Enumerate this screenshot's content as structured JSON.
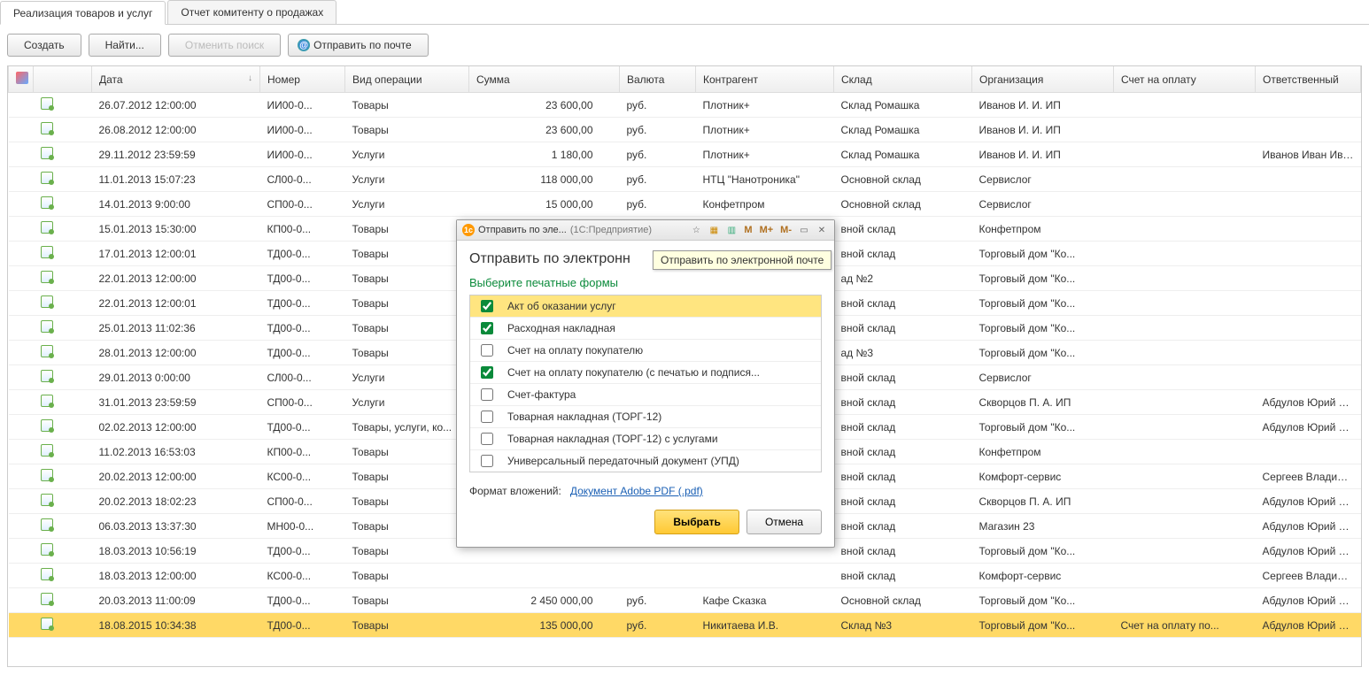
{
  "tabs": [
    {
      "label": "Реализация товаров и услуг",
      "active": true
    },
    {
      "label": "Отчет комитенту о продажах",
      "active": false
    }
  ],
  "toolbar": {
    "create": "Создать",
    "find": "Найти...",
    "cancel_search": "Отменить поиск",
    "send_email": "Отправить по почте"
  },
  "columns": [
    "",
    "",
    "Дата",
    "Номер",
    "Вид операции",
    "Сумма",
    "Валюта",
    "Контрагент",
    "Склад",
    "Организация",
    "Счет на оплату",
    "Ответственный"
  ],
  "rows": [
    {
      "date": "26.07.2012 12:00:00",
      "num": "ИИ00-0...",
      "op": "Товары",
      "sum": "23 600,00",
      "cur": "руб.",
      "cp": "Плотник+",
      "wh": "Склад Ромашка",
      "org": "Иванов И. И. ИП",
      "inv": "",
      "resp": ""
    },
    {
      "date": "26.08.2012 12:00:00",
      "num": "ИИ00-0...",
      "op": "Товары",
      "sum": "23 600,00",
      "cur": "руб.",
      "cp": "Плотник+",
      "wh": "Склад Ромашка",
      "org": "Иванов И. И. ИП",
      "inv": "",
      "resp": ""
    },
    {
      "date": "29.11.2012 23:59:59",
      "num": "ИИ00-0...",
      "op": "Услуги",
      "sum": "1 180,00",
      "cur": "руб.",
      "cp": "Плотник+",
      "wh": "Склад Ромашка",
      "org": "Иванов И. И. ИП",
      "inv": "",
      "resp": "Иванов Иван Иван..."
    },
    {
      "date": "11.01.2013 15:07:23",
      "num": "СЛ00-0...",
      "op": "Услуги",
      "sum": "118 000,00",
      "cur": "руб.",
      "cp": "НТЦ \"Нанотроника\"",
      "wh": "Основной склад",
      "org": "Сервислог",
      "inv": "",
      "resp": ""
    },
    {
      "date": "14.01.2013 9:00:00",
      "num": "СП00-0...",
      "op": "Услуги",
      "sum": "15 000,00",
      "cur": "руб.",
      "cp": "Конфетпром",
      "wh": "Основной склад",
      "org": "Сервислог",
      "inv": "",
      "resp": ""
    },
    {
      "date": "15.01.2013 15:30:00",
      "num": "КП00-0...",
      "op": "Товары",
      "sum": "",
      "cur": "",
      "cp": "",
      "wh": "вной склад",
      "org": "Конфетпром",
      "inv": "",
      "resp": ""
    },
    {
      "date": "17.01.2013 12:00:01",
      "num": "ТД00-0...",
      "op": "Товары",
      "sum": "",
      "cur": "",
      "cp": "",
      "wh": "вной склад",
      "org": "Торговый дом \"Ко...",
      "inv": "",
      "resp": ""
    },
    {
      "date": "22.01.2013 12:00:00",
      "num": "ТД00-0...",
      "op": "Товары",
      "sum": "",
      "cur": "",
      "cp": "",
      "wh": "ад №2",
      "org": "Торговый дом \"Ко...",
      "inv": "",
      "resp": ""
    },
    {
      "date": "22.01.2013 12:00:01",
      "num": "ТД00-0...",
      "op": "Товары",
      "sum": "",
      "cur": "",
      "cp": "",
      "wh": "вной склад",
      "org": "Торговый дом \"Ко...",
      "inv": "",
      "resp": ""
    },
    {
      "date": "25.01.2013 11:02:36",
      "num": "ТД00-0...",
      "op": "Товары",
      "sum": "",
      "cur": "",
      "cp": "",
      "wh": "вной склад",
      "org": "Торговый дом \"Ко...",
      "inv": "",
      "resp": ""
    },
    {
      "date": "28.01.2013 12:00:00",
      "num": "ТД00-0...",
      "op": "Товары",
      "sum": "",
      "cur": "",
      "cp": "",
      "wh": "ад №3",
      "org": "Торговый дом \"Ко...",
      "inv": "",
      "resp": ""
    },
    {
      "date": "29.01.2013 0:00:00",
      "num": "СЛ00-0...",
      "op": "Услуги",
      "sum": "",
      "cur": "",
      "cp": "",
      "wh": "вной склад",
      "org": "Сервислог",
      "inv": "",
      "resp": ""
    },
    {
      "date": "31.01.2013 23:59:59",
      "num": "СП00-0...",
      "op": "Услуги",
      "sum": "",
      "cur": "",
      "cp": "",
      "wh": "вной склад",
      "org": "Скворцов П. А. ИП",
      "inv": "",
      "resp": "Абдулов Юрий Вл..."
    },
    {
      "date": "02.02.2013 12:00:00",
      "num": "ТД00-0...",
      "op": "Товары, услуги, ко...",
      "sum": "",
      "cur": "",
      "cp": "",
      "wh": "вной склад",
      "org": "Торговый дом \"Ко...",
      "inv": "",
      "resp": "Абдулов Юрий Вл..."
    },
    {
      "date": "11.02.2013 16:53:03",
      "num": "КП00-0...",
      "op": "Товары",
      "sum": "",
      "cur": "",
      "cp": "",
      "wh": "вной склад",
      "org": "Конфетпром",
      "inv": "",
      "resp": ""
    },
    {
      "date": "20.02.2013 12:00:00",
      "num": "КС00-0...",
      "op": "Товары",
      "sum": "",
      "cur": "",
      "cp": "",
      "wh": "вной склад",
      "org": "Комфорт-сервис",
      "inv": "",
      "resp": "Сергеев Владими..."
    },
    {
      "date": "20.02.2013 18:02:23",
      "num": "СП00-0...",
      "op": "Товары",
      "sum": "",
      "cur": "",
      "cp": "",
      "wh": "вной склад",
      "org": "Скворцов П. А. ИП",
      "inv": "",
      "resp": "Абдулов Юрий Вл..."
    },
    {
      "date": "06.03.2013 13:37:30",
      "num": "МН00-0...",
      "op": "Товары",
      "sum": "",
      "cur": "",
      "cp": "",
      "wh": "вной склад",
      "org": "Магазин 23",
      "inv": "",
      "resp": "Абдулов Юрий Вл..."
    },
    {
      "date": "18.03.2013 10:56:19",
      "num": "ТД00-0...",
      "op": "Товары",
      "sum": "",
      "cur": "",
      "cp": "",
      "wh": "вной склад",
      "org": "Торговый дом \"Ко...",
      "inv": "",
      "resp": "Абдулов Юрий Вл..."
    },
    {
      "date": "18.03.2013 12:00:00",
      "num": "КС00-0...",
      "op": "Товары",
      "sum": "",
      "cur": "",
      "cp": "",
      "wh": "вной склад",
      "org": "Комфорт-сервис",
      "inv": "",
      "resp": "Сергеев Владими..."
    },
    {
      "date": "20.03.2013 11:00:09",
      "num": "ТД00-0...",
      "op": "Товары",
      "sum": "2 450 000,00",
      "cur": "руб.",
      "cp": "Кафе Сказка",
      "wh": "Основной склад",
      "org": "Торговый дом \"Ко...",
      "inv": "",
      "resp": "Абдулов Юрий Вл..."
    },
    {
      "date": "18.08.2015 10:34:38",
      "num": "ТД00-0...",
      "op": "Товары",
      "sum": "135 000,00",
      "cur": "руб.",
      "cp": "Никитаева И.В.",
      "wh": "Склад №3",
      "org": "Торговый дом \"Ко...",
      "inv": "Счет на оплату по...",
      "resp": "Абдулов Юрий Вл...",
      "selected": true
    }
  ],
  "dialog": {
    "window_title_short": "Отправить по эле...",
    "window_title_suffix": "(1С:Предприятие)",
    "heading": "Отправить по электронн",
    "subheading": "Выберите печатные формы",
    "forms": [
      {
        "label": "Акт об оказании услуг",
        "checked": true,
        "selected": true
      },
      {
        "label": "Расходная накладная",
        "checked": true
      },
      {
        "label": "Счет на оплату покупателю",
        "checked": false
      },
      {
        "label": "Счет на оплату покупателю (с печатью и подпися...",
        "checked": true
      },
      {
        "label": "Счет-фактура",
        "checked": false
      },
      {
        "label": "Товарная накладная (ТОРГ-12)",
        "checked": false
      },
      {
        "label": "Товарная накладная (ТОРГ-12) с услугами",
        "checked": false
      },
      {
        "label": "Универсальный передаточный документ (УПД)",
        "checked": false
      }
    ],
    "format_label": "Формат вложений:",
    "format_link": "Документ Adobe PDF (.pdf)",
    "select_btn": "Выбрать",
    "cancel_btn": "Отмена",
    "m_buttons": [
      "M",
      "M+",
      "M-"
    ]
  },
  "tooltip": "Отправить по электронной почте"
}
